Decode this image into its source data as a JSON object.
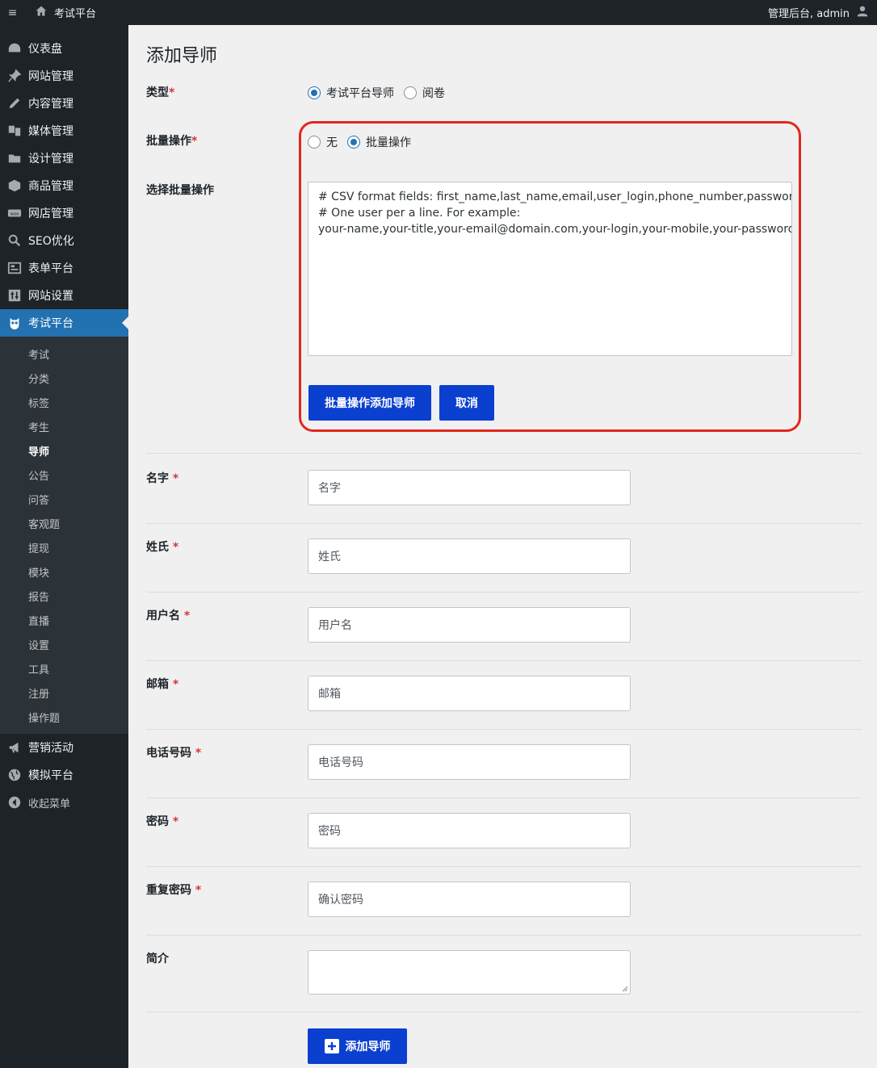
{
  "topbar": {
    "menu_icon": "≡",
    "site_name": "考试平台",
    "user_greeting": "管理后台, admin"
  },
  "sidebar": {
    "items_top": [
      {
        "label": "仪表盘",
        "icon": "dashboard-icon"
      },
      {
        "label": "网站管理",
        "icon": "pin-icon"
      },
      {
        "label": "内容管理",
        "icon": "edit-icon"
      },
      {
        "label": "媒体管理",
        "icon": "media-icon"
      },
      {
        "label": "设计管理",
        "icon": "folder-icon"
      },
      {
        "label": "商品管理",
        "icon": "box-icon"
      },
      {
        "label": "网店管理",
        "icon": "woo-icon"
      },
      {
        "label": "SEO优化",
        "icon": "search-icon"
      },
      {
        "label": "表单平台",
        "icon": "form-icon"
      },
      {
        "label": "网站设置",
        "icon": "settings-icon"
      },
      {
        "label": "考试平台",
        "icon": "owl-icon"
      }
    ],
    "submenu": [
      "考试",
      "分类",
      "标签",
      "考生",
      "导师",
      "公告",
      "问答",
      "客观题",
      "提现",
      "模块",
      "报告",
      "直播",
      "设置",
      "工具",
      "注册",
      "操作题"
    ],
    "items_bottom": [
      {
        "label": "营销活动",
        "icon": "megaphone-icon"
      },
      {
        "label": "模拟平台",
        "icon": "globe-icon"
      },
      {
        "label": "收起菜单",
        "icon": "collapse-icon"
      }
    ]
  },
  "page": {
    "title": "添加导师",
    "type_label": "类型",
    "type_options": [
      "考试平台导师",
      "阅卷"
    ],
    "bulk_label": "批量操作",
    "bulk_options": [
      "无",
      "批量操作"
    ],
    "select_bulk_label": "选择批量操作",
    "csv_text": "# CSV format fields: first_name,last_name,email,user_login,phone_number,password\n# One user per a line. For example:\nyour-name,your-title,your-email@domain.com,your-login,your-mobile,your-password",
    "bulk_add_button": "批量操作添加导师",
    "cancel_button": "取消",
    "required_mark": "*",
    "fields": [
      {
        "label": "名字",
        "placeholder": "名字"
      },
      {
        "label": "姓氏",
        "placeholder": "姓氏"
      },
      {
        "label": "用户名",
        "placeholder": "用户名"
      },
      {
        "label": "邮箱",
        "placeholder": "邮箱"
      },
      {
        "label": "电话号码",
        "placeholder": "电话号码"
      },
      {
        "label": "密码",
        "placeholder": "密码"
      },
      {
        "label": "重复密码",
        "placeholder": "确认密码"
      }
    ],
    "bio_label": "简介",
    "add_button": "添加导师"
  }
}
